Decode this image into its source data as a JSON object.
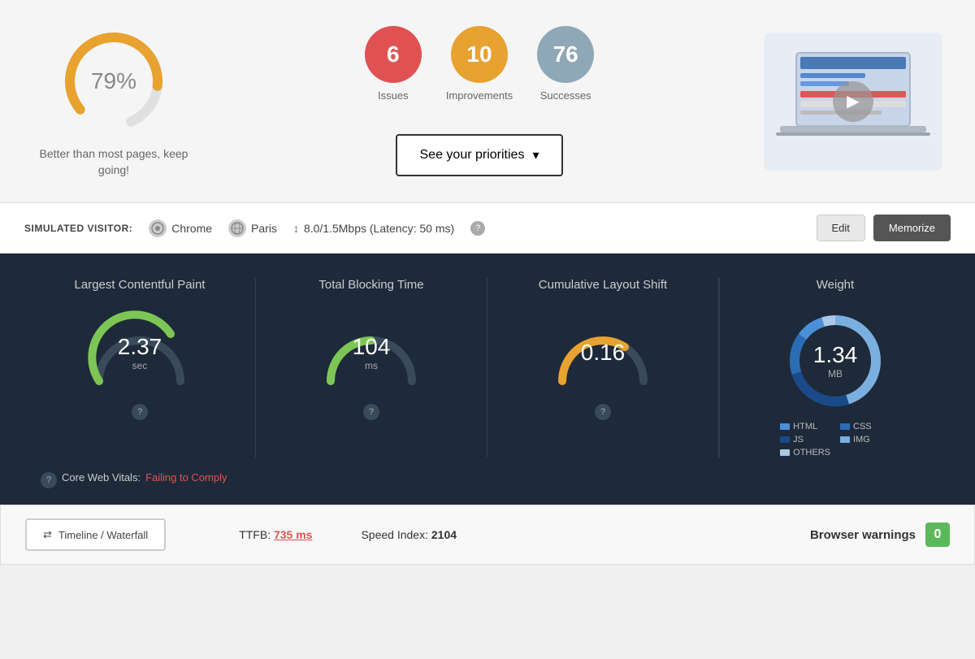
{
  "summary": {
    "score_value": "79%",
    "score_label": "Better than most pages, keep going!",
    "issues_count": "6",
    "issues_label": "Issues",
    "improvements_count": "10",
    "improvements_label": "Improvements",
    "successes_count": "76",
    "successes_label": "Successes",
    "priorities_button": "See your priorities",
    "priorities_chevron": "▾"
  },
  "visitor": {
    "label": "SIMULATED VISITOR:",
    "browser": "Chrome",
    "location": "Paris",
    "speed": "8.0/1.5Mbps (Latency: 50 ms)",
    "arrow_icon": "↕",
    "edit_button": "Edit",
    "memorize_button": "Memorize"
  },
  "cwv": {
    "lcp_title": "Largest Contentful Paint",
    "lcp_value": "2.37",
    "lcp_unit": "sec",
    "tbt_title": "Total Blocking Time",
    "tbt_value": "104",
    "tbt_unit": "ms",
    "cls_title": "Cumulative Layout Shift",
    "cls_value": "0.16",
    "cls_unit": "",
    "weight_title": "Weight",
    "weight_value": "1.34",
    "weight_unit": "MB",
    "core_vitals_label": "Core Web Vitals:",
    "core_vitals_status": "Failing to Comply",
    "question_mark": "?"
  },
  "weight_legend": [
    {
      "label": "HTML",
      "color": "#4a90d9"
    },
    {
      "label": "CSS",
      "color": "#2a6db5"
    },
    {
      "label": "JS",
      "color": "#1a4a8a"
    },
    {
      "label": "IMG",
      "color": "#7ab0e0"
    },
    {
      "label": "OTHERS",
      "color": "#aac8e8"
    }
  ],
  "bottom": {
    "timeline_icon": "↔",
    "timeline_label": "Timeline / Waterfall",
    "ttfb_label": "TTFB:",
    "ttfb_value": "735 ms",
    "speed_label": "Speed Index:",
    "speed_value": "2104",
    "warnings_label": "Browser warnings",
    "warnings_count": "0"
  }
}
